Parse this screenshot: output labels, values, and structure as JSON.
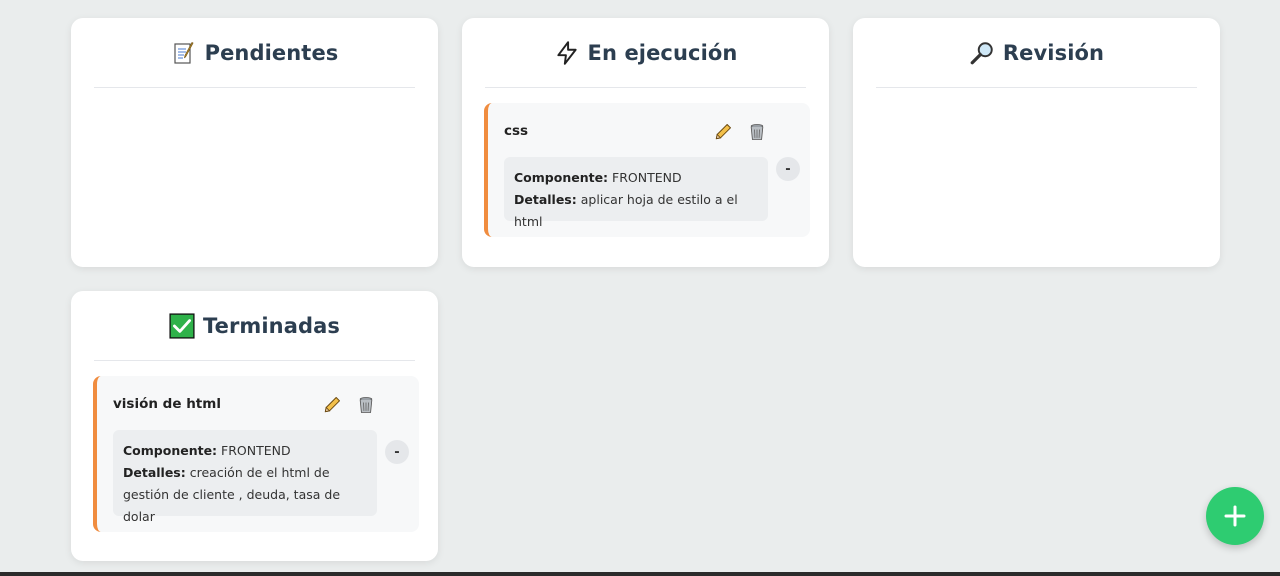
{
  "columns": [
    {
      "title": "Pendientes",
      "icon": "memo-icon",
      "tasks": []
    },
    {
      "title": "En ejecución",
      "icon": "lightning-icon",
      "tasks": [
        {
          "title": "css",
          "component_label": "Componente:",
          "component": "FRONTEND",
          "details_label": "Detalles:",
          "details": "aplicar hoja de estilo a el html",
          "collapse_label": "-"
        }
      ]
    },
    {
      "title": "Revisión",
      "icon": "magnifier-icon",
      "tasks": []
    },
    {
      "title": "Terminadas",
      "icon": "check-box-icon",
      "tasks": [
        {
          "title": "visión de html",
          "component_label": "Componente:",
          "component": "FRONTEND",
          "details_label": "Detalles:",
          "details": "creación de el html de gestión de cliente , deuda, tasa de dolar",
          "collapse_label": "-"
        }
      ]
    }
  ],
  "fab": {
    "icon": "plus-icon"
  },
  "colors": {
    "accent_border": "#f08c3f",
    "fab": "#2ecc71",
    "background": "#eaeded"
  }
}
